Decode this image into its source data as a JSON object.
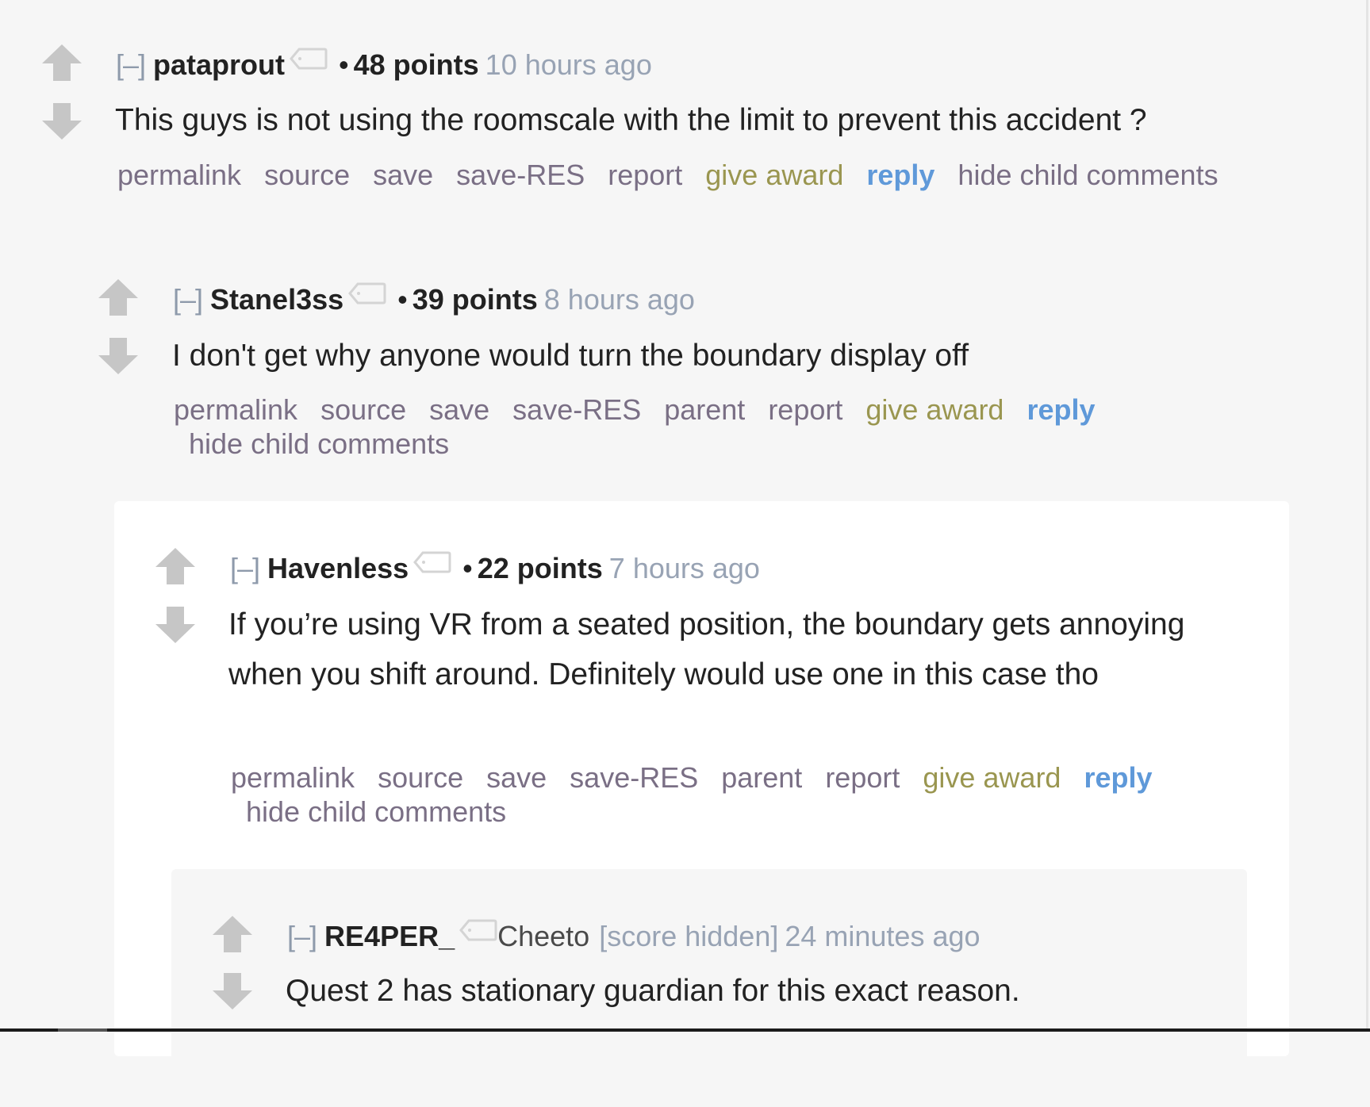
{
  "comments": [
    {
      "expand": "[–]",
      "author": "pataprout",
      "flair": "",
      "score": "48 points",
      "time": "10 hours ago",
      "body": "This guys is not using the roomscale with the limit to prevent this accident ?",
      "actions": {
        "permalink": "permalink",
        "source": "source",
        "save": "save",
        "save_res": "save-RES",
        "report": "report",
        "give_award": "give award",
        "reply": "reply",
        "hide_child": "hide child comments"
      }
    },
    {
      "expand": "[–]",
      "author": "Stanel3ss",
      "score": "39 points",
      "time": "8 hours ago",
      "body": "I don't get why anyone would turn the boundary display off",
      "actions": {
        "permalink": "permalink",
        "source": "source",
        "save": "save",
        "save_res": "save-RES",
        "parent": "parent",
        "report": "report",
        "give_award": "give award",
        "reply": "reply",
        "hide_child": "hide child comments"
      }
    },
    {
      "expand": "[–]",
      "author": "Havenless",
      "score": "22 points",
      "time": "7 hours ago",
      "body": "If you’re using VR from a seated position, the boundary gets annoying when you shift around. Definitely would use one in this case tho",
      "actions": {
        "permalink": "permalink",
        "source": "source",
        "save": "save",
        "save_res": "save-RES",
        "parent": "parent",
        "report": "report",
        "give_award": "give award",
        "reply": "reply",
        "hide_child": "hide child comments"
      }
    },
    {
      "expand": "[–]",
      "author": "RE4PER_",
      "flair": "Cheeto",
      "score": "[score hidden]",
      "time": "24 minutes ago",
      "body": "Quest 2 has stationary guardian for this exact reason."
    }
  ],
  "colors": {
    "background": "#f6f6f6",
    "link": "#7a6f85",
    "give_award": "#9a9650",
    "reply": "#5f99d9",
    "timestamp": "#98a3b4",
    "arrow": "#c6c6c6"
  }
}
